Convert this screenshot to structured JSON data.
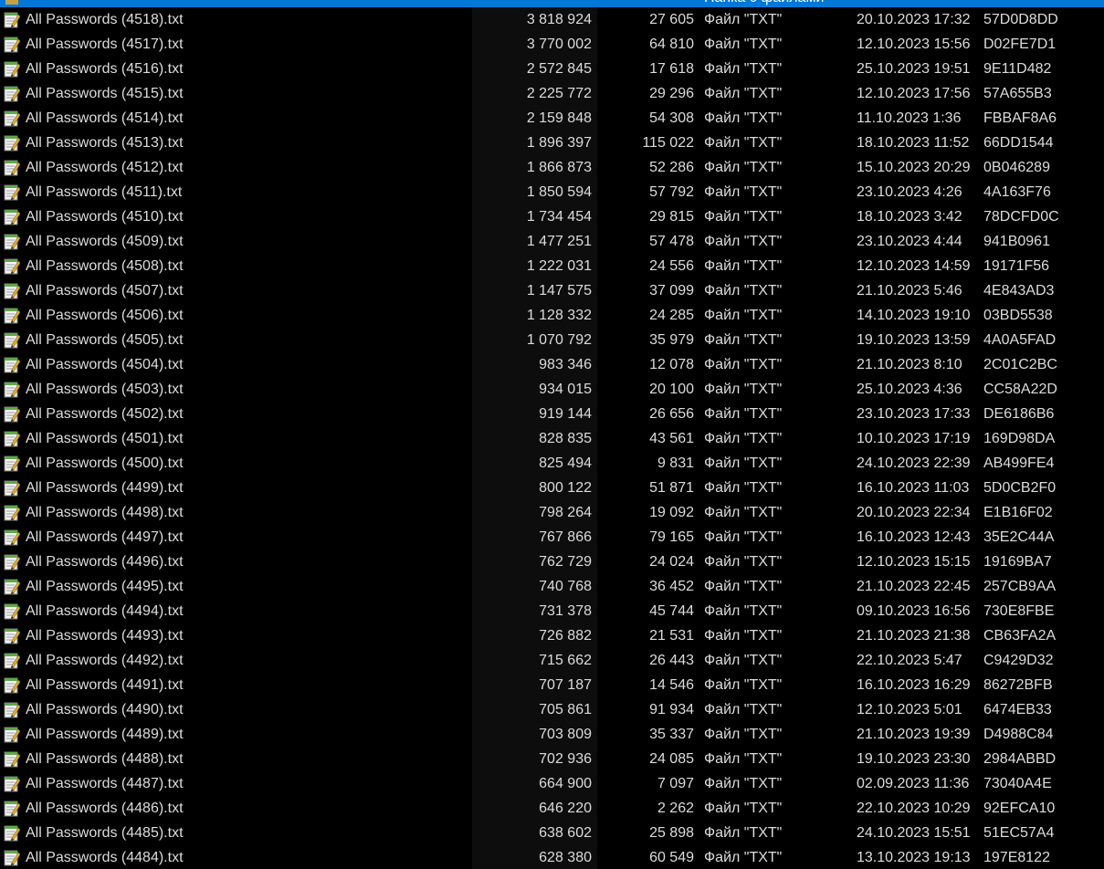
{
  "selected_row": {
    "name": "..",
    "type": "Папка с файлами"
  },
  "colors": {
    "selection": "#0078d7",
    "background": "#000000",
    "text": "#dcdcdc"
  },
  "file_icon": "notepad-text-file-icon",
  "files": [
    {
      "name": "All Passwords (4518).txt",
      "packed": "3 818 924",
      "size": "27 605",
      "type": "Файл \"TXT\"",
      "modified": "20.10.2023 17:32",
      "crc": "57D0D8DD"
    },
    {
      "name": "All Passwords (4517).txt",
      "packed": "3 770 002",
      "size": "64 810",
      "type": "Файл \"TXT\"",
      "modified": "12.10.2023 15:56",
      "crc": "D02FE7D1"
    },
    {
      "name": "All Passwords (4516).txt",
      "packed": "2 572 845",
      "size": "17 618",
      "type": "Файл \"TXT\"",
      "modified": "25.10.2023 19:51",
      "crc": "9E11D482"
    },
    {
      "name": "All Passwords (4515).txt",
      "packed": "2 225 772",
      "size": "29 296",
      "type": "Файл \"TXT\"",
      "modified": "12.10.2023 17:56",
      "crc": "57A655B3"
    },
    {
      "name": "All Passwords (4514).txt",
      "packed": "2 159 848",
      "size": "54 308",
      "type": "Файл \"TXT\"",
      "modified": "11.10.2023 1:36",
      "crc": "FBBAF8A6"
    },
    {
      "name": "All Passwords (4513).txt",
      "packed": "1 896 397",
      "size": "115 022",
      "type": "Файл \"TXT\"",
      "modified": "18.10.2023 11:52",
      "crc": "66DD1544"
    },
    {
      "name": "All Passwords (4512).txt",
      "packed": "1 866 873",
      "size": "52 286",
      "type": "Файл \"TXT\"",
      "modified": "15.10.2023 20:29",
      "crc": "0B046289"
    },
    {
      "name": "All Passwords (4511).txt",
      "packed": "1 850 594",
      "size": "57 792",
      "type": "Файл \"TXT\"",
      "modified": "23.10.2023 4:26",
      "crc": "4A163F76"
    },
    {
      "name": "All Passwords (4510).txt",
      "packed": "1 734 454",
      "size": "29 815",
      "type": "Файл \"TXT\"",
      "modified": "18.10.2023 3:42",
      "crc": "78DCFD0C"
    },
    {
      "name": "All Passwords (4509).txt",
      "packed": "1 477 251",
      "size": "57 478",
      "type": "Файл \"TXT\"",
      "modified": "23.10.2023 4:44",
      "crc": "941B0961"
    },
    {
      "name": "All Passwords (4508).txt",
      "packed": "1 222 031",
      "size": "24 556",
      "type": "Файл \"TXT\"",
      "modified": "12.10.2023 14:59",
      "crc": "19171F56"
    },
    {
      "name": "All Passwords (4507).txt",
      "packed": "1 147 575",
      "size": "37 099",
      "type": "Файл \"TXT\"",
      "modified": "21.10.2023 5:46",
      "crc": "4E843AD3"
    },
    {
      "name": "All Passwords (4506).txt",
      "packed": "1 128 332",
      "size": "24 285",
      "type": "Файл \"TXT\"",
      "modified": "14.10.2023 19:10",
      "crc": "03BD5538"
    },
    {
      "name": "All Passwords (4505).txt",
      "packed": "1 070 792",
      "size": "35 979",
      "type": "Файл \"TXT\"",
      "modified": "19.10.2023 13:59",
      "crc": "4A0A5FAD"
    },
    {
      "name": "All Passwords (4504).txt",
      "packed": "983 346",
      "size": "12 078",
      "type": "Файл \"TXT\"",
      "modified": "21.10.2023 8:10",
      "crc": "2C01C2BC"
    },
    {
      "name": "All Passwords (4503).txt",
      "packed": "934 015",
      "size": "20 100",
      "type": "Файл \"TXT\"",
      "modified": "25.10.2023 4:36",
      "crc": "CC58A22D"
    },
    {
      "name": "All Passwords (4502).txt",
      "packed": "919 144",
      "size": "26 656",
      "type": "Файл \"TXT\"",
      "modified": "23.10.2023 17:33",
      "crc": "DE6186B6"
    },
    {
      "name": "All Passwords (4501).txt",
      "packed": "828 835",
      "size": "43 561",
      "type": "Файл \"TXT\"",
      "modified": "10.10.2023 17:19",
      "crc": "169D98DA"
    },
    {
      "name": "All Passwords (4500).txt",
      "packed": "825 494",
      "size": "9 831",
      "type": "Файл \"TXT\"",
      "modified": "24.10.2023 22:39",
      "crc": "AB499FE4"
    },
    {
      "name": "All Passwords (4499).txt",
      "packed": "800 122",
      "size": "51 871",
      "type": "Файл \"TXT\"",
      "modified": "16.10.2023 11:03",
      "crc": "5D0CB2F0"
    },
    {
      "name": "All Passwords (4498).txt",
      "packed": "798 264",
      "size": "19 092",
      "type": "Файл \"TXT\"",
      "modified": "20.10.2023 22:34",
      "crc": "E1B16F02"
    },
    {
      "name": "All Passwords (4497).txt",
      "packed": "767 866",
      "size": "79 165",
      "type": "Файл \"TXT\"",
      "modified": "16.10.2023 12:43",
      "crc": "35E2C44A"
    },
    {
      "name": "All Passwords (4496).txt",
      "packed": "762 729",
      "size": "24 024",
      "type": "Файл \"TXT\"",
      "modified": "12.10.2023 15:15",
      "crc": "19169BA7"
    },
    {
      "name": "All Passwords (4495).txt",
      "packed": "740 768",
      "size": "36 452",
      "type": "Файл \"TXT\"",
      "modified": "21.10.2023 22:45",
      "crc": "257CB9AA"
    },
    {
      "name": "All Passwords (4494).txt",
      "packed": "731 378",
      "size": "45 744",
      "type": "Файл \"TXT\"",
      "modified": "09.10.2023 16:56",
      "crc": "730E8FBE"
    },
    {
      "name": "All Passwords (4493).txt",
      "packed": "726 882",
      "size": "21 531",
      "type": "Файл \"TXT\"",
      "modified": "21.10.2023 21:38",
      "crc": "CB63FA2A"
    },
    {
      "name": "All Passwords (4492).txt",
      "packed": "715 662",
      "size": "26 443",
      "type": "Файл \"TXT\"",
      "modified": "22.10.2023 5:47",
      "crc": "C9429D32"
    },
    {
      "name": "All Passwords (4491).txt",
      "packed": "707 187",
      "size": "14 546",
      "type": "Файл \"TXT\"",
      "modified": "16.10.2023 16:29",
      "crc": "86272BFB"
    },
    {
      "name": "All Passwords (4490).txt",
      "packed": "705 861",
      "size": "91 934",
      "type": "Файл \"TXT\"",
      "modified": "12.10.2023 5:01",
      "crc": "6474EB33"
    },
    {
      "name": "All Passwords (4489).txt",
      "packed": "703 809",
      "size": "35 337",
      "type": "Файл \"TXT\"",
      "modified": "21.10.2023 19:39",
      "crc": "D4988C84"
    },
    {
      "name": "All Passwords (4488).txt",
      "packed": "702 936",
      "size": "24 085",
      "type": "Файл \"TXT\"",
      "modified": "19.10.2023 23:30",
      "crc": "2984ABBD"
    },
    {
      "name": "All Passwords (4487).txt",
      "packed": "664 900",
      "size": "7 097",
      "type": "Файл \"TXT\"",
      "modified": "02.09.2023 11:36",
      "crc": "73040A4E"
    },
    {
      "name": "All Passwords (4486).txt",
      "packed": "646 220",
      "size": "2 262",
      "type": "Файл \"TXT\"",
      "modified": "22.10.2023 10:29",
      "crc": "92EFCA10"
    },
    {
      "name": "All Passwords (4485).txt",
      "packed": "638 602",
      "size": "25 898",
      "type": "Файл \"TXT\"",
      "modified": "24.10.2023 15:51",
      "crc": "51EC57A4"
    },
    {
      "name": "All Passwords (4484).txt",
      "packed": "628 380",
      "size": "60 549",
      "type": "Файл \"TXT\"",
      "modified": "13.10.2023 19:13",
      "crc": "197E8122"
    }
  ]
}
